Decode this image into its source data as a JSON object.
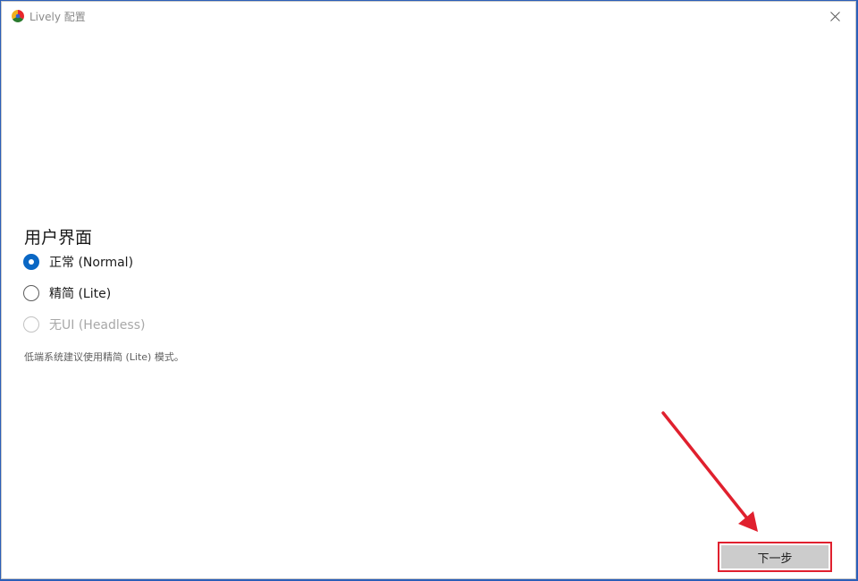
{
  "window": {
    "title": "Lively 配置",
    "close_icon": "close-icon",
    "app_icon": "lively-app-icon"
  },
  "ui_section": {
    "heading": "用户界面",
    "options": [
      {
        "label": "正常 (Normal)",
        "checked": true,
        "disabled": false
      },
      {
        "label": "精简 (Lite)",
        "checked": false,
        "disabled": false
      },
      {
        "label": "无UI (Headless)",
        "checked": false,
        "disabled": true
      }
    ],
    "hint": "低端系统建议使用精简 (Lite) 模式。"
  },
  "footer": {
    "next_label": "下一步"
  },
  "colors": {
    "accent": "#0a67c4",
    "highlight": "#e0202e",
    "button_bg": "#cccccc"
  }
}
